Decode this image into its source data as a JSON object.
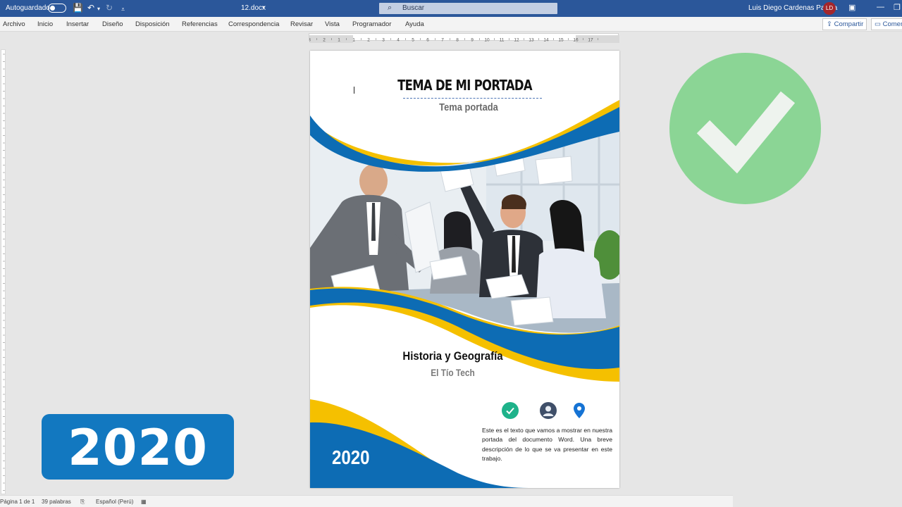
{
  "titlebar": {
    "autosave_label": "Autoguardado",
    "doc_name": "12.docx",
    "search_placeholder": "Buscar",
    "user_name": "Luis Diego Cardenas Padilla",
    "user_initials": "LD"
  },
  "ribbon": {
    "tabs": [
      "Archivo",
      "Inicio",
      "Insertar",
      "Diseño",
      "Disposición",
      "Referencias",
      "Correspondencia",
      "Revisar",
      "Vista",
      "Programador",
      "Ayuda"
    ],
    "share_label": "Compartir",
    "comments_label": "Comentarios"
  },
  "ruler": {
    "labels": [
      "3",
      "2",
      "1",
      "1",
      "2",
      "3",
      "4",
      "5",
      "6",
      "7",
      "8",
      "9",
      "10",
      "11",
      "12",
      "13",
      "14",
      "15",
      "16",
      "17"
    ]
  },
  "document": {
    "cover_title": "TEMA DE MI PORTADA",
    "cover_subtitle": "Tema portada",
    "subject": "Historia y Geografía",
    "author": "El Tío Tech",
    "year": "2020",
    "description": "Este es el texto que vamos a mostrar en nuestra portada del documento Word. Una breve descripción de lo que se va presentar en este trabajo."
  },
  "overlay": {
    "badge_year": "2020"
  },
  "statusbar": {
    "page": "Página 1 de 1",
    "words": "39 palabras",
    "language": "Español (Perú)"
  },
  "colors": {
    "title_bar": "#2b579a",
    "page_blue": "#0d6cb4",
    "page_yellow": "#f5c000",
    "check_green": "#8bd595",
    "badge_blue": "#1278c0",
    "icon_teal": "#1eb28a"
  }
}
